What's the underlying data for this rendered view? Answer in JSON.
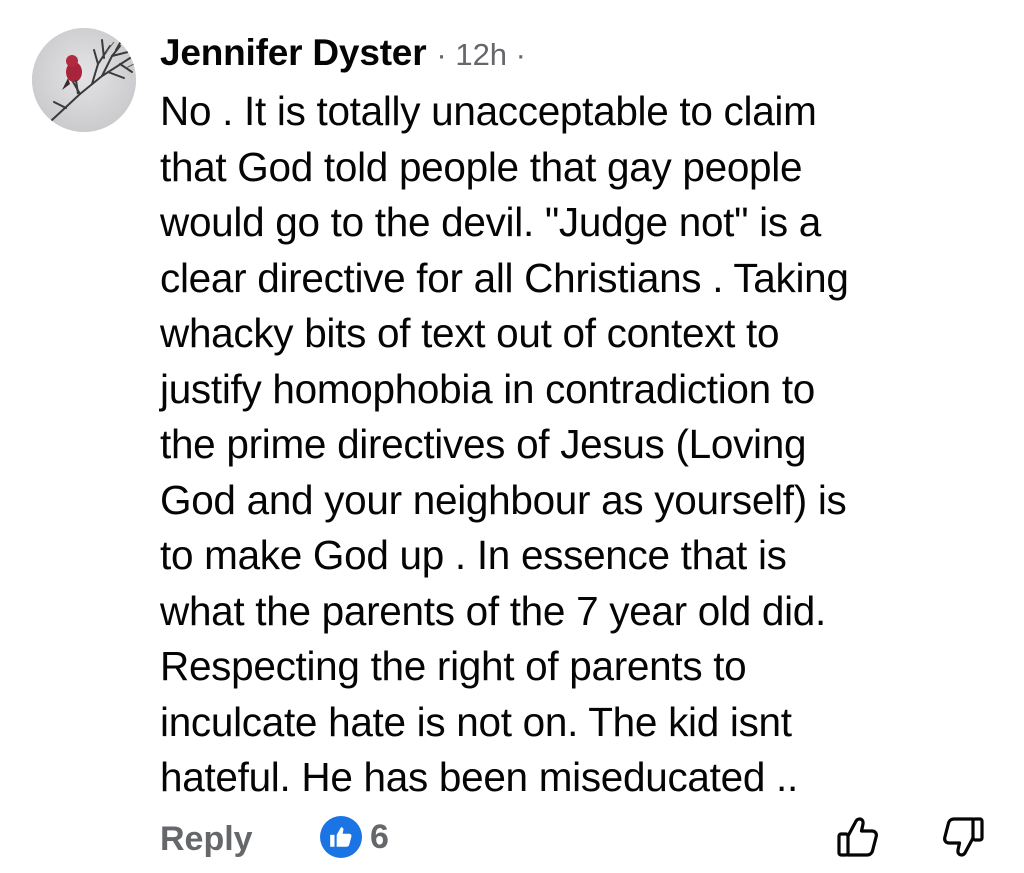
{
  "comment": {
    "author": "Jennifer Dyster",
    "meta": "· 12h ·",
    "avatar_icon": "bird-on-branch-avatar",
    "text": "No . It is totally unacceptable to claim\nthat God told people that gay people\nwould go to the devil. \"Judge not\" is a\nclear directive for all Christians . Taking\nwhacky bits  of text out of context to\njustify homophobia  in contradiction to\nthe prime directives of Jesus (Loving\nGod and your neighbour as yourself) is\nto make God up . In essence that is\nwhat the parents of the 7 year old did.\nRespecting the right of parents to\ninculcate hate is not on. The kid isnt\nhateful. He has been miseducated ..",
    "actions": {
      "reply_label": "Reply",
      "reaction_icon": "like-icon",
      "reaction_count": "6",
      "like_icon": "thumbs-up-outline-icon",
      "dislike_icon": "thumbs-down-outline-icon"
    }
  },
  "colors": {
    "text": "#050505",
    "secondary": "#65676b",
    "like_blue": "#1b74e4"
  }
}
